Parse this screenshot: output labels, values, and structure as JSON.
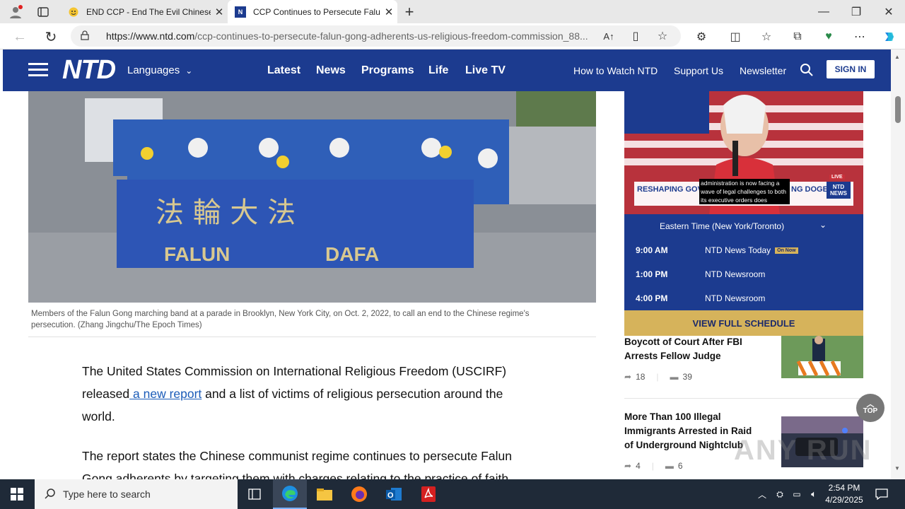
{
  "browser": {
    "tabs": [
      {
        "title": "END CCP - End The Evil Chinese"
      },
      {
        "title": "CCP Continues to Persecute Falu"
      }
    ],
    "url_domain": "https://www.ntd.com",
    "url_path": "/ccp-continues-to-persecute-falun-gong-adherents-us-religious-freedom-commission_88..."
  },
  "site": {
    "logo": "NTD",
    "languages": "Languages",
    "nav": [
      "Latest",
      "News",
      "Programs",
      "Life",
      "Live TV"
    ],
    "secondary_nav": [
      "How to Watch NTD",
      "Support Us",
      "Newsletter"
    ],
    "sign_in": "SIGN IN"
  },
  "photo": {
    "banner_chars": "法 輪 大 法",
    "banner_word1": "FALUN",
    "banner_word2": "DAFA"
  },
  "caption": "Members of the Falun Gong marching band at a parade in Brooklyn, New York City, on Oct. 2, 2022, to call an end to the Chinese regime's persecution. (Zhang Jingchu/The Epoch Times)",
  "article": {
    "p1_before": "The United States Commission on International Religious Freedom (USCIRF) released",
    "p1_link": " a new report",
    "p1_after": " and a list of victims of religious persecution around the world.",
    "p2": "The report states the Chinese communist regime continues to persecute Falun Gong adherents by targeting them with charges relating to the practice of faith."
  },
  "live": {
    "ticker_left": "RESHAPING GOV",
    "ticker_mid": "administration is now facing a wave of legal challenges to both its executive orders does",
    "ticker_right": "NG DOGE",
    "badge_live": "LIVE",
    "badge_logo": "NTD NEWS"
  },
  "schedule": {
    "timezone": "Eastern Time (New York/Toronto)",
    "rows": [
      {
        "time": "9:00 AM",
        "show": "NTD News Today",
        "badge": "On Now"
      },
      {
        "time": "1:00 PM",
        "show": "NTD Newsroom",
        "badge": ""
      },
      {
        "time": "4:00 PM",
        "show": "NTD Newsroom",
        "badge": ""
      }
    ],
    "view_all": "VIEW FULL SCHEDULE"
  },
  "sidebar_news": [
    {
      "title": "Boycott of Court After FBI Arrests Fellow Judge",
      "shares": "18",
      "comments": "39"
    },
    {
      "title": "More Than 100 Illegal Immigrants Arrested in Raid of Underground Nightclub",
      "shares": "4",
      "comments": "6"
    }
  ],
  "top_button": "TOP",
  "watermark": "ANY RUN",
  "taskbar": {
    "search_placeholder": "Type here to search",
    "time": "2:54 PM",
    "date": "4/29/2025"
  },
  "colors": {
    "ntd_blue": "#1c3b8f",
    "gold": "#d6b35b",
    "taskbar": "#1f2a38"
  }
}
